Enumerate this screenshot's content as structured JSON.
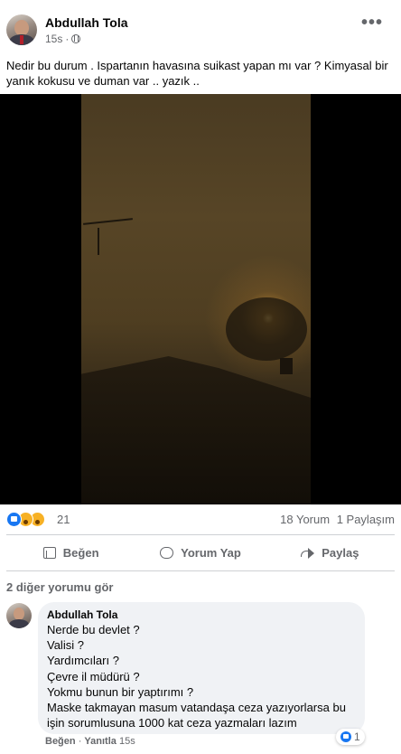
{
  "post": {
    "author": "Abdullah Tola",
    "time": "15s",
    "separator": "·",
    "text": "Nedir bu durum . Ispartanın havasına suikast yapan mı var ? Kimyasal bir yanık kokusu ve duman var .. yazık .."
  },
  "video": {
    "mute_label": "×"
  },
  "stats": {
    "reaction_count": "21",
    "comments": "18 Yorum",
    "shares": "1 Paylaşım",
    "reactions": [
      "like-icon",
      "sad-icon",
      "wow-icon"
    ]
  },
  "actions": {
    "like": "Beğen",
    "comment": "Yorum Yap",
    "share": "Paylaş"
  },
  "comments_section": {
    "view_more": "2 diğer yorumu gör",
    "comment": {
      "author": "Abdullah Tola",
      "lines": [
        "Nerde bu devlet ?",
        "Valisi ?",
        "Yardımcıları ?",
        "Çevre il müdürü ?",
        "Yokmu bunun bir yaptırımı ?",
        "Maske takmayan masum vatandaşa ceza yazıyorlarsa bu",
        "işin sorumlusuna 1000 kat ceza yazmaları lazım"
      ],
      "reaction_count": "1",
      "like": "Beğen",
      "reply": "Yanıtla",
      "time": "15s",
      "separator": "·"
    }
  },
  "colors": {
    "accent": "#1877f2",
    "secondary_text": "#65676b",
    "bubble": "#f0f2f5"
  }
}
